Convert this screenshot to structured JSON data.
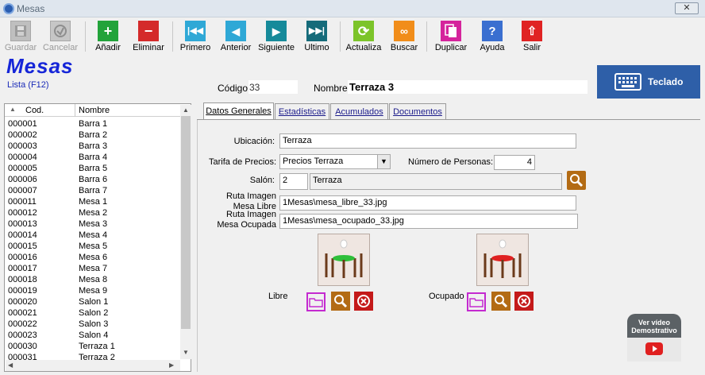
{
  "window": {
    "title": "Mesas",
    "close_label": "✕"
  },
  "toolbar": {
    "guardar": "Guardar",
    "cancelar": "Cancelar",
    "anadir": "Añadir",
    "eliminar": "Eliminar",
    "primero": "Primero",
    "anterior": "Anterior",
    "siguiente": "Siguiente",
    "ultimo": "Ultimo",
    "actualiza": "Actualiza",
    "buscar": "Buscar",
    "duplicar": "Duplicar",
    "ayuda": "Ayuda",
    "salir": "Salir"
  },
  "header": {
    "title": "Mesas",
    "lista": "Lista (F12)",
    "codigo_label": "Código:",
    "codigo_value": "33",
    "nombre_label": "Nombre:",
    "nombre_value": "Terraza 3",
    "teclado": "Teclado"
  },
  "list": {
    "col_cod": "Cod.",
    "col_nombre": "Nombre",
    "rows": [
      {
        "cod": "000001",
        "nombre": "Barra 1"
      },
      {
        "cod": "000002",
        "nombre": "Barra 2"
      },
      {
        "cod": "000003",
        "nombre": "Barra 3"
      },
      {
        "cod": "000004",
        "nombre": "Barra 4"
      },
      {
        "cod": "000005",
        "nombre": "Barra 5"
      },
      {
        "cod": "000006",
        "nombre": "Barra 6"
      },
      {
        "cod": "000007",
        "nombre": "Barra 7"
      },
      {
        "cod": "000011",
        "nombre": "Mesa 1"
      },
      {
        "cod": "000012",
        "nombre": "Mesa 2"
      },
      {
        "cod": "000013",
        "nombre": "Mesa 3"
      },
      {
        "cod": "000014",
        "nombre": "Mesa 4"
      },
      {
        "cod": "000015",
        "nombre": "Mesa 5"
      },
      {
        "cod": "000016",
        "nombre": "Mesa 6"
      },
      {
        "cod": "000017",
        "nombre": "Mesa 7"
      },
      {
        "cod": "000018",
        "nombre": "Mesa 8"
      },
      {
        "cod": "000019",
        "nombre": "Mesa 9"
      },
      {
        "cod": "000020",
        "nombre": "Salon 1"
      },
      {
        "cod": "000021",
        "nombre": "Salon 2"
      },
      {
        "cod": "000022",
        "nombre": "Salon 3"
      },
      {
        "cod": "000023",
        "nombre": "Salon 4"
      },
      {
        "cod": "000030",
        "nombre": "Terraza 1"
      },
      {
        "cod": "000031",
        "nombre": "Terraza 2"
      }
    ]
  },
  "tabs": {
    "datos": "Datos Generales",
    "estadisticas": "Estadísticas",
    "acumulados": "Acumulados",
    "documentos": "Documentos"
  },
  "form": {
    "ubicacion_label": "Ubicación:",
    "ubicacion_value": "Terraza",
    "tarifa_label": "Tarifa de Precios:",
    "tarifa_value": "Precios Terraza",
    "personas_label": "Número de Personas:",
    "personas_value": "4",
    "salon_label": "Salón:",
    "salon_code": "2",
    "salon_name": "Terraza",
    "ruta_libre_label1": "Ruta Imagen",
    "ruta_libre_label2": "Mesa Libre",
    "ruta_libre_value": "1Mesas\\mesa_libre_33.jpg",
    "ruta_ocupada_label1": "Ruta Imagen",
    "ruta_ocupada_label2": "Mesa Ocupada",
    "ruta_ocupada_value": "1Mesas\\mesa_ocupado_33.jpg",
    "libre_label": "Libre",
    "ocupado_label": "Ocupado"
  },
  "video": {
    "line1": "Ver vídeo",
    "line2": "Demostrativo"
  }
}
